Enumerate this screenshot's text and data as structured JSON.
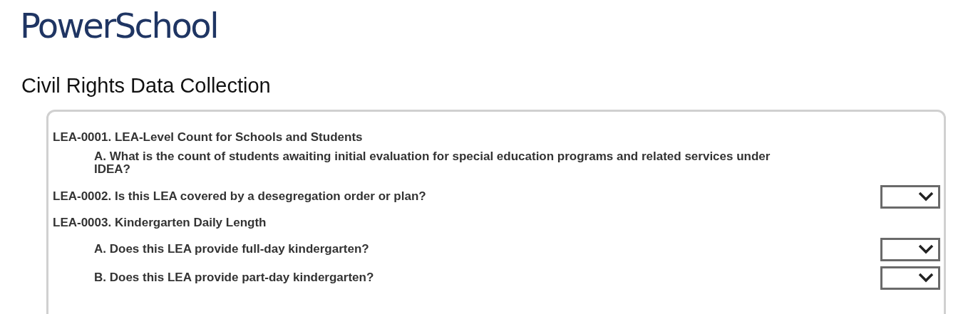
{
  "logo": "PowerSchool",
  "title": "Civil Rights Data Collection",
  "sections": [
    {
      "label": "LEA-0001. LEA-Level Count for Schools and Students",
      "dropdown": false,
      "children": [
        {
          "label": "A. What is the count of students awaiting initial evaluation for special education programs and related services under IDEA?",
          "dropdown": false
        }
      ]
    },
    {
      "label": "LEA-0002. Is this LEA covered by a desegregation order or plan?",
      "dropdown": true
    },
    {
      "label": "LEA-0003. Kindergarten Daily Length",
      "dropdown": false,
      "children": [
        {
          "label": "A. Does this LEA provide full-day kindergarten?",
          "dropdown": true
        },
        {
          "label": "B. Does this LEA provide part-day kindergarten?",
          "dropdown": true
        }
      ]
    }
  ]
}
